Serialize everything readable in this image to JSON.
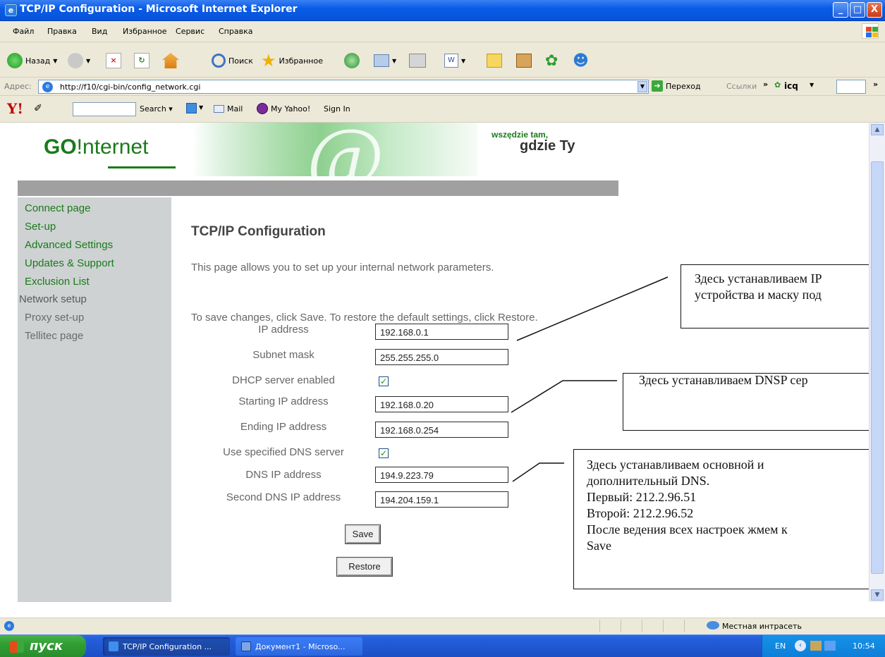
{
  "window": {
    "title": "TCP/IP Configuration - Microsoft Internet Explorer",
    "controls": [
      "_",
      "□",
      "X"
    ]
  },
  "menu": [
    "Файл",
    "Правка",
    "Вид",
    "Избранное",
    "Сервис",
    "Справка"
  ],
  "toolbar": {
    "back_label": "Назад",
    "search_label": "Поиск",
    "favorites_label": "Избранное"
  },
  "address": {
    "label": "Адрес:",
    "url": "http://f10/cgi-bin/config_network.cgi",
    "go_label": "Переход",
    "links_label": "Ссылки",
    "icq_label": "icq"
  },
  "yahoo": {
    "logo": "Y!",
    "search_label": "Search",
    "mail_label": "Mail",
    "my_yahoo_label": "My Yahoo!",
    "sign_in_label": "Sign In"
  },
  "banner": {
    "logo_go": "GO",
    "logo_internet": "!nternet",
    "at_symbol": "@",
    "slogan_line1": "wszędzie tam,",
    "slogan_line2": "gdzie Ty"
  },
  "sidebar": [
    {
      "label": "Connect page",
      "color": "#1a7a1a"
    },
    {
      "label": "Set-up",
      "color": "#1a7a1a"
    },
    {
      "label": "Advanced Settings",
      "color": "#1a7a1a"
    },
    {
      "label": "Updates & Support",
      "color": "#1a7a1a"
    },
    {
      "label": "Exclusion List",
      "color": "#1a7a1a"
    },
    {
      "label": "Network setup",
      "color": "#5a5a5a"
    },
    {
      "label": "Proxy set-up",
      "color": "#6a6a6a"
    },
    {
      "label": "Tellitec page",
      "color": "#6a6a6a"
    }
  ],
  "main": {
    "heading": "TCP/IP Configuration",
    "desc1": "This page allows you to set up your internal network parameters.",
    "desc2": "To save changes, click Save. To restore the default settings, click Restore.",
    "fields": [
      {
        "label": "IP address",
        "value": "192.168.0.1"
      },
      {
        "label": "Subnet mask",
        "value": "255.255.255.0"
      },
      {
        "label": "DHCP server enabled",
        "checked": true
      },
      {
        "label": "Starting IP address",
        "value": "192.168.0.20"
      },
      {
        "label": "Ending IP address",
        "value": "192.168.0.254"
      },
      {
        "label": "Use specified DNS server",
        "checked": true
      },
      {
        "label": "DNS IP address",
        "value": "194.9.223.79"
      },
      {
        "label": "Second DNS IP address",
        "value": "194.204.159.1"
      }
    ],
    "save_label": "Save",
    "restore_label": "Restore"
  },
  "callouts": [
    {
      "lines": [
        "Здесь устанавливаем IP",
        "устройства и маску под"
      ]
    },
    {
      "lines": [
        "Здесь устанавливаем DNSP сер"
      ]
    },
    {
      "lines": [
        "Здесь устанавливаем основной и",
        "дополнительный DNS.",
        "Первый: 212.2.96.51",
        "Второй: 212.2.96.52",
        "После ведения всех настроек жмем к",
        "Save"
      ]
    }
  ],
  "status": {
    "zone": "Местная интрасеть"
  },
  "taskbar": {
    "start_label": "пуск",
    "tasks": [
      "TCP/IP Configuration ...",
      "Документ1 - Microso..."
    ],
    "lang": "EN",
    "clock": "10:54"
  },
  "colors": {
    "accent_green": "#1a7a1a",
    "title_blue": "#0a5ce8",
    "sidebar_grey": "#ced2d3"
  }
}
